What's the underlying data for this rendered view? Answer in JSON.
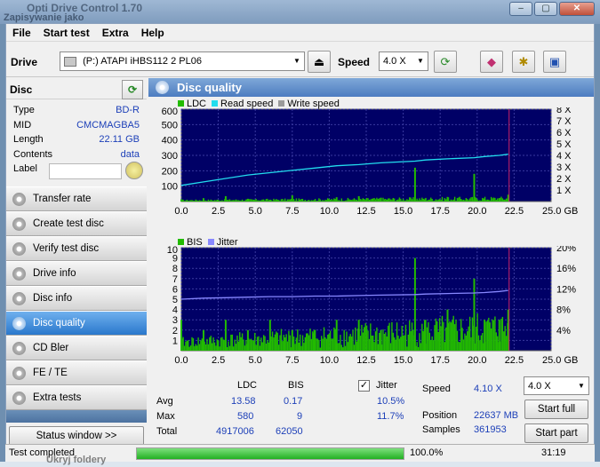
{
  "window": {
    "title": "Opti Drive Control 1.70",
    "subtitle_overlay": "Zapisywanie jako",
    "minimize": "–",
    "maximize": "▢",
    "close": "✕"
  },
  "menu": {
    "items": [
      "File",
      "Start test",
      "Extra",
      "Help"
    ]
  },
  "toolbar": {
    "drive_label": "Drive",
    "drive_value": "(P:)   ATAPI iHBS112   2 PL06",
    "speed_label": "Speed",
    "speed_value": "4.0 X"
  },
  "disc": {
    "header": "Disc",
    "rows": [
      {
        "key": "Type",
        "value": "BD-R"
      },
      {
        "key": "MID",
        "value": "CMCMAGBA5"
      },
      {
        "key": "Length",
        "value": "22.11 GB"
      },
      {
        "key": "Contents",
        "value": "data"
      },
      {
        "key": "Label",
        "value": ""
      }
    ]
  },
  "nav": {
    "items": [
      "Transfer rate",
      "Create test disc",
      "Verify test disc",
      "Drive info",
      "Disc info",
      "Disc quality",
      "CD Bler",
      "FE / TE",
      "Extra tests"
    ],
    "active": "Disc quality",
    "status_window": "Status window >>"
  },
  "main": {
    "title": "Disc quality",
    "legend_top": [
      "LDC",
      "Read speed",
      "Write speed"
    ],
    "legend_bottom": [
      "BIS",
      "Jitter"
    ],
    "colors": {
      "ldc": "#22bb00",
      "read": "#22ddee",
      "write": "#9a9a9a",
      "bis": "#22bb00",
      "jitter": "#8888ff",
      "plot_bg": "#000066"
    }
  },
  "chart_data": [
    {
      "type": "bar",
      "title": "",
      "series": [
        {
          "name": "LDC",
          "values": [
            15,
            22,
            35,
            18,
            12,
            40,
            10,
            28,
            35,
            25,
            220,
            20,
            30,
            180,
            20,
            22,
            45
          ]
        },
        {
          "name": "Read speed",
          "values": [
            1.4,
            1.7,
            2.0,
            2.3,
            2.5,
            2.7,
            2.9,
            3.1,
            3.2,
            3.35,
            3.5,
            3.6,
            3.7,
            3.8,
            3.9,
            4.0,
            4.1
          ]
        }
      ],
      "x": [
        0.0,
        1.5,
        3.0,
        4.5,
        6.0,
        7.5,
        9.0,
        10.5,
        12.0,
        13.5,
        15.8,
        16.5,
        18.0,
        19.8,
        20.5,
        21.5,
        22.1
      ],
      "xlabel": "GB",
      "ylabel": "",
      "xlim": [
        0,
        25
      ],
      "ylim": [
        0,
        600
      ],
      "yticks_left": [
        "600",
        "500",
        "400",
        "300",
        "200",
        "100"
      ],
      "yticks_right": [
        "8 X",
        "7 X",
        "6 X",
        "5 X",
        "4 X",
        "3 X",
        "2 X",
        "1 X"
      ],
      "xticks": [
        "0.0",
        "2.5",
        "5.0",
        "7.5",
        "10.0",
        "12.5",
        "15.0",
        "17.5",
        "20.0",
        "22.5",
        "25.0 GB"
      ]
    },
    {
      "type": "bar",
      "title": "",
      "series": [
        {
          "name": "BIS",
          "values": [
            3,
            2,
            3,
            2,
            3,
            2,
            2,
            3,
            3,
            2,
            9,
            3,
            4,
            7,
            3,
            3,
            4
          ]
        },
        {
          "name": "Jitter",
          "values": [
            10.0,
            10.2,
            10.3,
            10.4,
            10.5,
            10.5,
            10.6,
            10.6,
            10.7,
            10.8,
            10.9,
            11.0,
            11.1,
            11.2,
            11.3,
            11.5,
            11.7
          ]
        }
      ],
      "x": [
        0.0,
        1.5,
        3.0,
        4.5,
        6.0,
        7.5,
        9.0,
        10.5,
        12.0,
        13.5,
        15.8,
        16.5,
        18.0,
        19.8,
        20.5,
        21.5,
        22.1
      ],
      "xlabel": "GB",
      "ylabel": "",
      "xlim": [
        0,
        25
      ],
      "ylim": [
        0,
        10
      ],
      "yticks_left": [
        "10",
        "9",
        "8",
        "7",
        "6",
        "5",
        "4",
        "3",
        "2",
        "1"
      ],
      "yticks_right": [
        "20%",
        "16%",
        "12%",
        "8%",
        "4%"
      ],
      "xticks": [
        "0.0",
        "2.5",
        "5.0",
        "7.5",
        "10.0",
        "12.5",
        "15.0",
        "17.5",
        "20.0",
        "22.5",
        "25.0 GB"
      ]
    }
  ],
  "stats": {
    "col_ldc": "LDC",
    "col_bis": "BIS",
    "jitter_label": "Jitter",
    "jitter_checked": "✓",
    "avg_label": "Avg",
    "max_label": "Max",
    "total_label": "Total",
    "avg_ldc": "13.58",
    "avg_bis": "0.17",
    "avg_jitter": "10.5%",
    "max_ldc": "580",
    "max_bis": "9",
    "max_jitter": "11.7%",
    "total_ldc": "4917006",
    "total_bis": "62050",
    "speed_label": "Speed",
    "speed_value": "4.10 X",
    "position_label": "Position",
    "position_value": "22637 MB",
    "samples_label": "Samples",
    "samples_value": "361953",
    "speed_select": "4.0 X",
    "start_full": "Start full",
    "start_part": "Start part"
  },
  "status": {
    "text": "Test completed",
    "progress": 1.0,
    "percent": "100.0%",
    "time": "31:19"
  },
  "bottom_overlay": "Ukryj foldery"
}
